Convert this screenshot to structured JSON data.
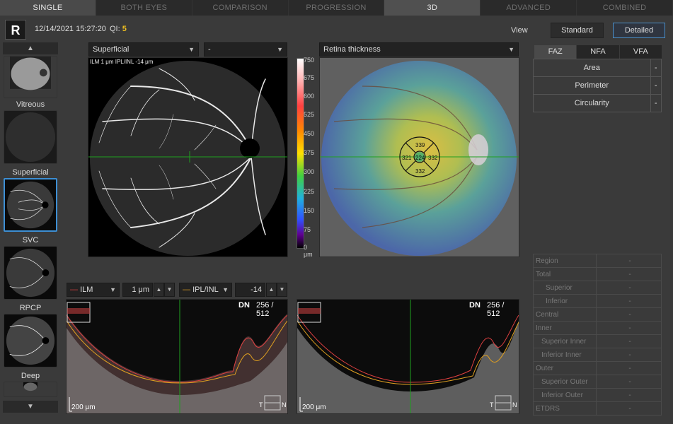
{
  "tabs": [
    "SINGLE",
    "BOTH EYES",
    "COMPARISON",
    "PROGRESSION",
    "3D",
    "ADVANCED",
    "COMBINED"
  ],
  "header": {
    "eye": "R",
    "datetime": "12/14/2021 15:27:20",
    "qi_label": "QI:",
    "qi_value": "5",
    "view_label": "View",
    "standard": "Standard",
    "detailed": "Detailed"
  },
  "thumbs": {
    "vitreous": "Vitreous",
    "superficial": "Superficial",
    "svc": "SVC",
    "rpcp": "RPCP",
    "deep": "Deep"
  },
  "left_panel": {
    "layer_select": "Superficial",
    "second_select": "-",
    "overlay": "ILM 1 μm   IPL/INL -14 μm"
  },
  "right_panel": {
    "map_select": "Retina thickness"
  },
  "scale": {
    "ticks": [
      "750",
      "675",
      "600",
      "525",
      "450",
      "375",
      "300",
      "225",
      "150",
      "75",
      "0"
    ],
    "unit": "μm"
  },
  "etdrs": {
    "top": "339",
    "left": "321",
    "center": "224",
    "right": "332",
    "bottom": "332"
  },
  "side_tabs": [
    "FAZ",
    "NFA",
    "VFA"
  ],
  "faz_table": [
    {
      "label": "Area",
      "value": "-"
    },
    {
      "label": "Perimeter",
      "value": "-"
    },
    {
      "label": "Circularity",
      "value": "-"
    }
  ],
  "region_table": [
    {
      "label": "Region",
      "value": "-",
      "indent": 0
    },
    {
      "label": "Total",
      "value": "-",
      "indent": 0
    },
    {
      "label": "Superior",
      "value": "-",
      "indent": 2
    },
    {
      "label": "Inferior",
      "value": "-",
      "indent": 2
    },
    {
      "label": "Central",
      "value": "-",
      "indent": 0
    },
    {
      "label": "Inner",
      "value": "-",
      "indent": 0
    },
    {
      "label": "Superior Inner",
      "value": "-",
      "indent": 1
    },
    {
      "label": "Inferior Inner",
      "value": "-",
      "indent": 1
    },
    {
      "label": "Outer",
      "value": "-",
      "indent": 0
    },
    {
      "label": "Superior Outer",
      "value": "-",
      "indent": 1
    },
    {
      "label": "Inferior Outer",
      "value": "-",
      "indent": 1
    },
    {
      "label": "ETDRS",
      "value": "-",
      "indent": 0
    }
  ],
  "bscan_controls": {
    "upper_layer": "ILM",
    "upper_offset": "1 μm",
    "lower_layer": "IPL/INL",
    "lower_offset": "-14 μm"
  },
  "bscan_left": {
    "direction": "DN",
    "slice": "256 / 512",
    "scale": "200 μm",
    "t": "T",
    "n": "N"
  },
  "bscan_right": {
    "direction": "DN",
    "slice": "256 / 512",
    "scale": "200 μm",
    "t": "T",
    "n": "N"
  },
  "colors": {
    "accent": "#3d8fd4",
    "qi": "#f0c020",
    "ilm_line": "#e04040",
    "ipl_line": "#e0a020",
    "crosshair": "#1fa01f"
  }
}
